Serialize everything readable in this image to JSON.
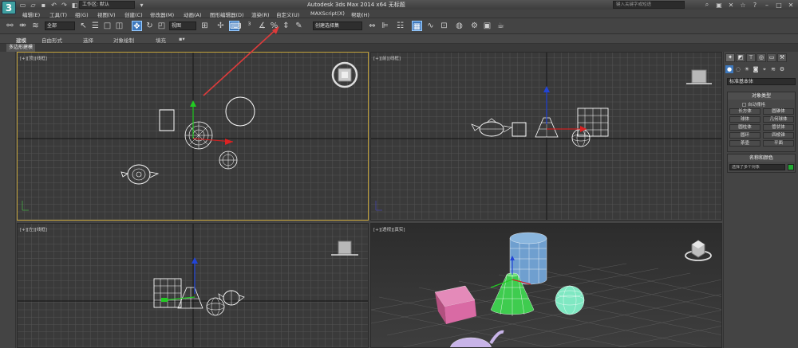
{
  "window": {
    "workspace": "工作区: 默认",
    "title": "Autodesk 3ds Max  2014 x64      无标题",
    "search_placeholder": "键入关键字或短语"
  },
  "menu": [
    "编辑(E)",
    "工具(T)",
    "组(G)",
    "视图(V)",
    "创建(C)",
    "修改器(M)",
    "动画(A)",
    "图形编辑器(D)",
    "渲染(R)",
    "自定义(U)",
    "MAXScript(X)",
    "帮助(H)"
  ],
  "toolbar": {
    "selection_filter": "全部",
    "reference_coord": "视图",
    "named_selection": "创建选择集"
  },
  "ribbon": {
    "tabs": [
      "建模",
      "自由形式",
      "选择",
      "对象绘制",
      "填充"
    ],
    "sub_label": "多边形建模"
  },
  "viewports": {
    "top": "[+][顶][线框]",
    "front": "[+][前][线框]",
    "left": "[+][左][线框]",
    "perspective": "[+][透视][真实]"
  },
  "command_panel": {
    "category": "标准基本体",
    "object_type_header": "对象类型",
    "autogrid": "自动栅格",
    "buttons": [
      "长方体",
      "圆锥体",
      "球体",
      "几何球体",
      "圆柱体",
      "管状体",
      "圆环",
      "四棱锥",
      "茶壶",
      "平面"
    ],
    "name_color_header": "名称和颜色",
    "name_value": "选择了多个对象",
    "object_color": "#22aa33"
  },
  "colors": {
    "selected_border": "#c2a23c",
    "annotation_arrow": "#dd3b3b",
    "box_pink": "#d96aa4",
    "cone_green": "#3fcc4f",
    "cylinder_blue": "#6f9fcf",
    "sphere_mint": "#7fe8c2",
    "teapot_lavender": "#c8b4e8"
  }
}
